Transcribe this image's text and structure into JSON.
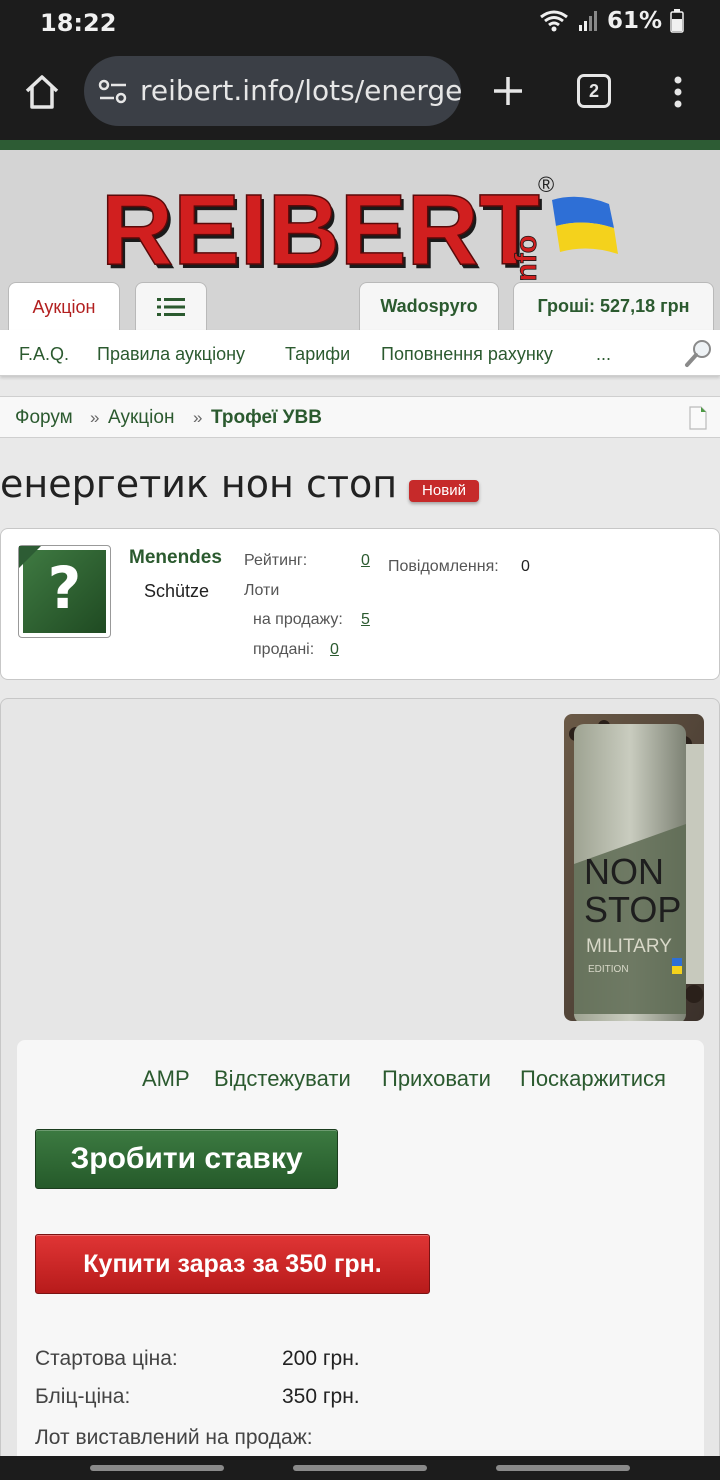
{
  "status_bar": {
    "time": "18:22",
    "battery": "61%"
  },
  "browser": {
    "url": "reibert.info/lots/energe",
    "tab_count": "2"
  },
  "site": {
    "logo_text": "REIBERT",
    "logo_suffix": "info",
    "logo_mark": "®",
    "tabs": {
      "auction": "Аукціон",
      "user": "Wadospyro",
      "money": "Гроші: 527,18 грн"
    },
    "subnav": [
      "F.A.Q.",
      "Правила аукціону",
      "Тарифи",
      "Поповнення рахунку",
      "..."
    ]
  },
  "breadcrumb": {
    "forum": "Форум",
    "sep": "»",
    "auction": "Аукціон",
    "current": "Трофеї УВВ"
  },
  "lot": {
    "title": "енергетик нон стоп",
    "badge": "Новий",
    "image_text": [
      "NON",
      "STOP",
      "MILITARY",
      "EDITION"
    ]
  },
  "seller": {
    "name": "Menendes",
    "rank": "Schütze",
    "rating_label": "Рейтинг:",
    "rating_value": "0",
    "messages_label": "Повідомлення:",
    "messages_value": "0",
    "lots_label": "Лоти",
    "for_sale_label": "на продажу:",
    "for_sale_value": "5",
    "sold_label": "продані:",
    "sold_value": "0"
  },
  "actions": {
    "amp": "AMP",
    "track": "Відстежувати",
    "hide": "Приховати",
    "report": "Поскаржитися",
    "bid_button": "Зробити ставку",
    "buy_button": "Купити зараз за 350 грн."
  },
  "info": {
    "start_price_label": "Стартова ціна:",
    "start_price_value": "200 грн.",
    "blitz_price_label": "Бліц-ціна:",
    "blitz_price_value": "350 грн.",
    "listed_label": "Лот виставлений на продаж:"
  },
  "colors": {
    "brand_green": "#2b5a2f",
    "brand_red": "#c62a2a",
    "header_bg": "#d4d4d4"
  }
}
